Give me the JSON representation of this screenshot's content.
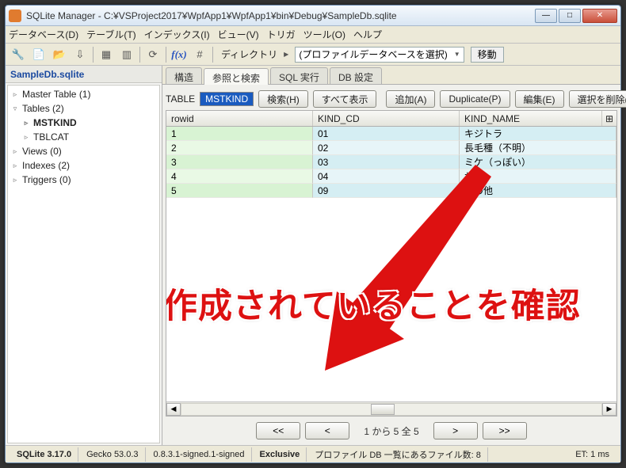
{
  "window": {
    "title": "SQLite Manager - C:¥VSProject2017¥WpfApp1¥WpfApp1¥bin¥Debug¥SampleDb.sqlite"
  },
  "menu": {
    "database": "データベース(D)",
    "table": "テーブル(T)",
    "index": "インデックス(I)",
    "view": "ビュー(V)",
    "trigger": "トリガ",
    "tool": "ツール(O)",
    "help": "ヘルプ"
  },
  "toolbar": {
    "dir_label": "ディレクトリ",
    "profile_combo": "(プロファイルデータベースを選択)",
    "move": "移動"
  },
  "sidebar": {
    "title": "SampleDb.sqlite",
    "items": [
      {
        "label": "Master Table (1)",
        "level": 1
      },
      {
        "label": "Tables (2)",
        "level": 1
      },
      {
        "label": "MSTKIND",
        "level": 2,
        "bold": true
      },
      {
        "label": "TBLCAT",
        "level": 2
      },
      {
        "label": "Views (0)",
        "level": 1
      },
      {
        "label": "Indexes (2)",
        "level": 1
      },
      {
        "label": "Triggers (0)",
        "level": 1
      }
    ]
  },
  "tabs": {
    "structure": "構造",
    "browse": "参照と検索",
    "execsql": "SQL 実行",
    "dbsettings": "DB 設定"
  },
  "tablebar": {
    "label": "TABLE",
    "name": "MSTKIND",
    "search": "検索(H)",
    "showall": "すべて表示",
    "add": "追加(A)",
    "duplicate": "Duplicate(P)",
    "edit": "編集(E)",
    "deletesel": "選択を削除(L)"
  },
  "grid": {
    "columns": {
      "rowid": "rowid",
      "kind_cd": "KIND_CD",
      "kind_name": "KIND_NAME"
    },
    "rows": [
      {
        "rowid": "1",
        "KIND_CD": "01",
        "KIND_NAME": "キジトラ"
      },
      {
        "rowid": "2",
        "KIND_CD": "02",
        "KIND_NAME": "長毛種（不明）"
      },
      {
        "rowid": "3",
        "KIND_CD": "03",
        "KIND_NAME": "ミケ（っぽい）"
      },
      {
        "rowid": "4",
        "KIND_CD": "04",
        "KIND_NAME": "サビ"
      },
      {
        "rowid": "5",
        "KIND_CD": "09",
        "KIND_NAME": "その他"
      }
    ]
  },
  "pager": {
    "first": "<<",
    "prev": "<",
    "text": "1 から 5 全 5",
    "next": ">",
    "last": ">>"
  },
  "status": {
    "sqlite": "SQLite 3.17.0",
    "gecko": "Gecko 53.0.3",
    "ext": "0.8.3.1-signed.1-signed",
    "mode": "Exclusive",
    "profile": "プロファイル DB 一覧にあるファイル数: 8",
    "et": "ET: 1 ms"
  },
  "annotation": "データが作成されていることを確認"
}
